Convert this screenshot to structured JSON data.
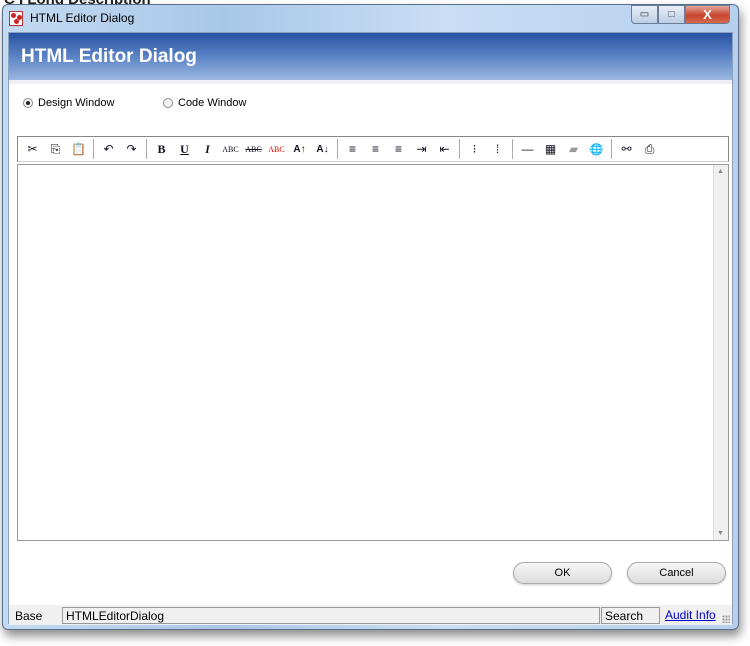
{
  "background_text": "C I Long Description",
  "window": {
    "title": "HTML Editor Dialog",
    "minimize": "▭",
    "maximize": "□",
    "close": "X"
  },
  "header": {
    "title": "HTML Editor Dialog"
  },
  "mode": {
    "options": [
      {
        "label": "Design Window",
        "selected": true
      },
      {
        "label": "Code Window",
        "selected": false
      }
    ]
  },
  "toolbar": {
    "groups": [
      [
        {
          "icon": "cut-icon",
          "glyph": "✂"
        },
        {
          "icon": "copy-icon",
          "glyph": "⎘"
        },
        {
          "icon": "paste-icon",
          "glyph": "📋"
        }
      ],
      [
        {
          "icon": "undo-icon",
          "glyph": "↶"
        },
        {
          "icon": "redo-icon",
          "glyph": "↷"
        }
      ],
      [
        {
          "icon": "bold-icon",
          "glyph": "B"
        },
        {
          "icon": "underline-icon",
          "glyph": "U"
        },
        {
          "icon": "italic-icon",
          "glyph": "I"
        },
        {
          "icon": "abc-icon",
          "glyph": "ABC"
        },
        {
          "icon": "strikethrough-icon",
          "glyph": "ABC"
        },
        {
          "icon": "spellcheck-icon",
          "glyph": "ABC"
        },
        {
          "icon": "sort-ascending-icon",
          "glyph": "A↑"
        },
        {
          "icon": "sort-descending-icon",
          "glyph": "A↓"
        }
      ],
      [
        {
          "icon": "align-left-icon",
          "glyph": "≡"
        },
        {
          "icon": "align-center-icon",
          "glyph": "≡"
        },
        {
          "icon": "align-right-icon",
          "glyph": "≡"
        },
        {
          "icon": "indent-icon",
          "glyph": "⇥"
        },
        {
          "icon": "outdent-icon",
          "glyph": "⇤"
        }
      ],
      [
        {
          "icon": "bulleted-list-icon",
          "glyph": "⁝"
        },
        {
          "icon": "numbered-list-icon",
          "glyph": "⁞"
        }
      ],
      [
        {
          "icon": "horizontal-rule-icon",
          "glyph": "—"
        },
        {
          "icon": "table-icon",
          "glyph": "▦"
        },
        {
          "icon": "image-icon",
          "glyph": "▰"
        },
        {
          "icon": "globe-link-icon",
          "glyph": "🌐"
        }
      ],
      [
        {
          "icon": "find-binoculars-icon",
          "glyph": "⚯"
        },
        {
          "icon": "print-icon",
          "glyph": "⎙"
        }
      ]
    ]
  },
  "editor": {
    "content": ""
  },
  "buttons": {
    "ok": "OK",
    "cancel": "Cancel"
  },
  "status": {
    "label": "Base",
    "form_name": "HTMLEditorDialog",
    "search": "Search",
    "audit_link": "Audit Info"
  }
}
